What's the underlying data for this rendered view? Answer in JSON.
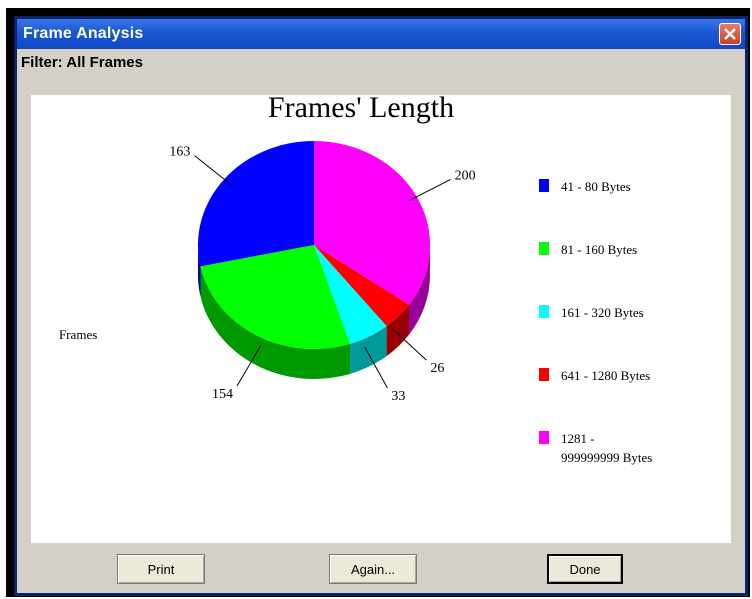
{
  "window": {
    "title": "Frame Analysis",
    "filter_label": "Filter: All Frames"
  },
  "chart_data": {
    "type": "pie",
    "title": "Frames' Length",
    "ylabel": "Frames",
    "legend_position": "right",
    "three_d": true,
    "slices": [
      {
        "label": "1281 - 999999999 Bytes",
        "legend_lines": [
          "1281 -",
          "999999999 Bytes"
        ],
        "value": 200,
        "color": "#ff00ff"
      },
      {
        "label": "641 - 1280 Bytes",
        "legend_lines": [
          "641 - 1280 Bytes"
        ],
        "value": 26,
        "color": "#ff0000"
      },
      {
        "label": "161 - 320 Bytes",
        "legend_lines": [
          "161 - 320 Bytes"
        ],
        "value": 33,
        "color": "#00ffff"
      },
      {
        "label": "81 - 160 Bytes",
        "legend_lines": [
          "81 - 160 Bytes"
        ],
        "value": 154,
        "color": "#00ff00"
      },
      {
        "label": "41 - 80 Bytes",
        "legend_lines": [
          "41 - 80 Bytes"
        ],
        "value": 163,
        "color": "#0000ff"
      }
    ],
    "legend_order": [
      "41 - 80 Bytes",
      "81 - 160 Bytes",
      "161 - 320 Bytes",
      "641 - 1280 Bytes",
      "1281 - 999999999 Bytes"
    ]
  },
  "buttons": {
    "print": "Print",
    "again": "Again...",
    "done": "Done"
  },
  "icons": {
    "close": "close-icon"
  }
}
